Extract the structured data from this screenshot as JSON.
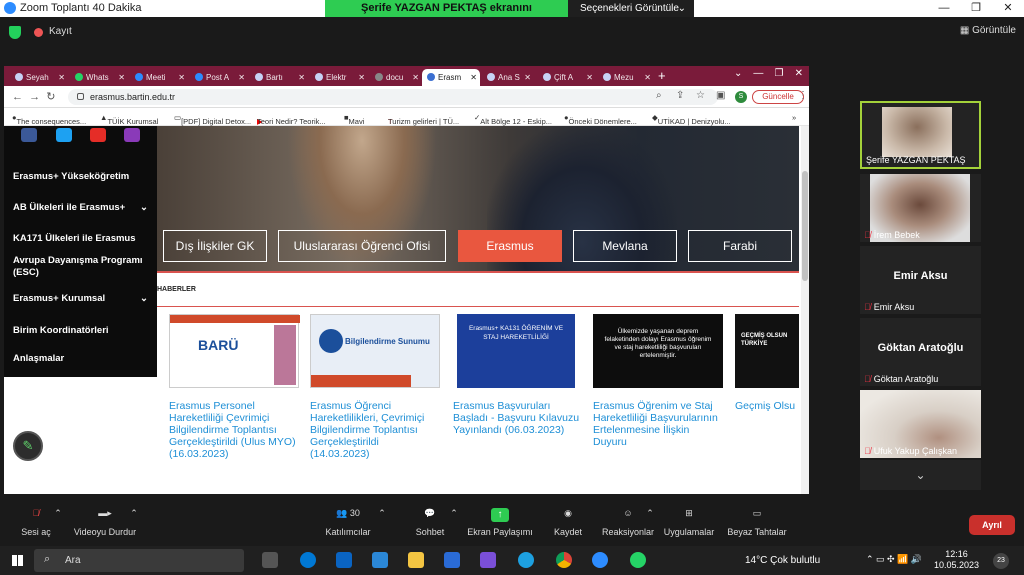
{
  "zoom": {
    "window_title": "Zoom Toplantı 40 Dakika",
    "share_banner": "Şerife YAZGAN PEKTAŞ ekranını görüntülüyorsunuz",
    "view_options": "Seçenekleri Görüntüle",
    "recording": "Kayıt",
    "view_button": "Görüntüle",
    "end_button": "Ayrıl"
  },
  "browser": {
    "tabs": [
      "Seyah",
      "Whats",
      "Meeti",
      "Post A",
      "Bartı",
      "Elektr",
      "docu",
      "Erasm",
      "Ana S",
      "Çift A",
      "Mezu"
    ],
    "url": "erasmus.bartin.edu.tr",
    "profile_letter": "S",
    "update_button": "Güncelle",
    "bookmarks": [
      "The consequences...",
      "TÜİK Kurumsal",
      "[PDF] Digital Detox...",
      "Teori Nedir? Teorik...",
      "Mavi",
      "Turizm gelirleri | TÜ...",
      "Alt Bölge 12 - Eskip...",
      "Önceki Dönemlere...",
      "UTİKAD | Denizyolu..."
    ]
  },
  "site": {
    "sidebar": [
      {
        "label": "Erasmus+ Yükseköğretim",
        "chevron": false
      },
      {
        "label": "AB Ülkeleri ile Erasmus+",
        "chevron": true
      },
      {
        "label": "KA171 Ülkeleri ile Erasmus",
        "chevron": false
      },
      {
        "label": "Avrupa Dayanışma Programı (ESC)",
        "chevron": false
      },
      {
        "label": "Erasmus+ Kurumsal",
        "chevron": true
      },
      {
        "label": "Birim Koordinatörleri",
        "chevron": false
      },
      {
        "label": "Anlaşmalar",
        "chevron": false
      }
    ],
    "hero_tabs": [
      "Dış İlişkiler GK",
      "Uluslararası Öğrenci Ofisi",
      "Erasmus",
      "Mevlana",
      "Farabi"
    ],
    "news_heading": "HABERLER",
    "news": [
      {
        "title": "Erasmus Personel Hareketliliği Çevrimiçi Bilgilendirme Toplantısı Gerçekleştirildi (Ulus MYO) (16.03.2023)",
        "thumb_text": "BARÜ"
      },
      {
        "title": "Erasmus Öğrenci Hareketlilikleri, Çevrimiçi Bilgilendirme Toplantısı Gerçekleştirildi (14.03.2023)",
        "thumb_text": "Bilgilendirme Sunumu"
      },
      {
        "title": "Erasmus Başvuruları Başladı - Başvuru Kılavuzu Yayınlandı (06.03.2023)",
        "thumb_text": "Erasmus+ KA131 ÖĞRENİM VE STAJ HAREKETLİLİĞİ"
      },
      {
        "title": "Erasmus Öğrenim ve Staj Hareketliliği Başvurularının Ertelenmesine İlişkin Duyuru",
        "thumb_text": "Ülkemizde yaşanan deprem felaketinden dolayı Erasmus öğrenim ve staj hareketliliği başvuruları ertelenmiştir."
      },
      {
        "title": "Geçmiş Olsu",
        "thumb_text": "GEÇMİŞ OLSUN TÜRKİYE"
      }
    ]
  },
  "participants": [
    {
      "name": "Şerife YAZGAN PEKTAŞ",
      "muted": false,
      "video": true
    },
    {
      "name": "İrem Bebek",
      "muted": true,
      "video": true
    },
    {
      "name": "Emir Aksu",
      "muted": true,
      "video": false,
      "display": "Emir Aksu"
    },
    {
      "name": "Göktan Aratoğlu",
      "muted": true,
      "video": false,
      "display": "Göktan Aratoğlu"
    },
    {
      "name": "Ufuk Yakup Çalışkan",
      "muted": true,
      "video": true
    }
  ],
  "toolbar": {
    "mute": "Sesi aç",
    "video": "Videoyu Durdur",
    "participants": "Katılımcılar",
    "participant_count": "30",
    "chat": "Sohbet",
    "share": "Ekran Paylaşımı",
    "record": "Kaydet",
    "reactions": "Reaksiyonlar",
    "apps": "Uygulamalar",
    "whiteboard": "Beyaz Tahtalar"
  },
  "taskbar": {
    "search": "Ara",
    "weather": "14°C  Çok bulutlu",
    "time": "12:16",
    "date": "10.05.2023",
    "notifications": "23"
  }
}
